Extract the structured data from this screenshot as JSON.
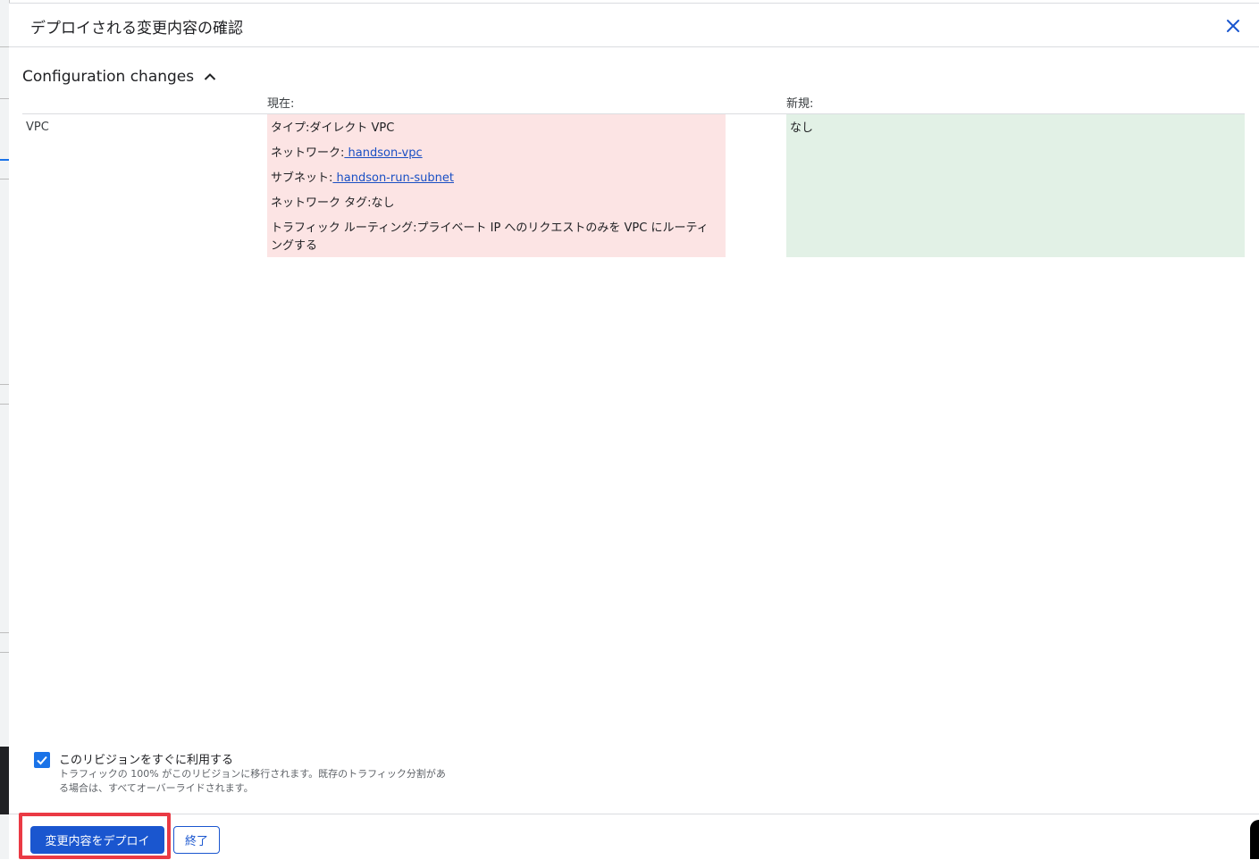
{
  "dialog": {
    "title": "デプロイされる変更内容の確認",
    "close_icon": "close-icon"
  },
  "section": {
    "title": "Configuration changes",
    "toggle_icon": "chevron-up-icon"
  },
  "columns": {
    "current": "現在:",
    "new": "新規:"
  },
  "rows": [
    {
      "label": "VPC",
      "current": {
        "type_prefix": "タイプ:ダイレクト VPC",
        "network_prefix": "ネットワーク:",
        "network_link": " handson-vpc",
        "subnet_prefix": "サブネット:",
        "subnet_link": " handson-run-subnet",
        "tags": "ネットワーク タグ:なし",
        "routing": "トラフィック ルーティング:プライベート IP へのリクエストのみを VPC にルーティングする"
      },
      "new": {
        "value": "なし"
      }
    }
  ],
  "option": {
    "checked": true,
    "label": "このリビジョンをすぐに利用する",
    "help": "トラフィックの 100% がこのリビジョンに移行されます。既存のトラフィック分割がある場合は、すべてオーバーライドされます。"
  },
  "footer": {
    "deploy_label": "変更内容をデプロイ",
    "finish_label": "終了"
  },
  "colors": {
    "primary": "#1a56cf",
    "current_bg": "#fce4e4",
    "new_bg": "#e2f1e6",
    "highlight": "#ea3a44"
  }
}
